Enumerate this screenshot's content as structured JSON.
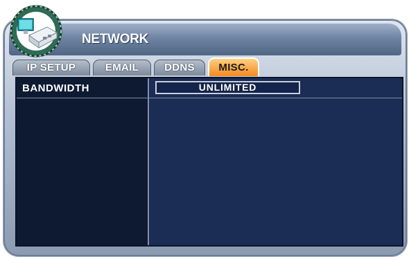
{
  "window": {
    "title": "NETWORK",
    "logo_icon": "network-dvr-icon"
  },
  "tabs": [
    {
      "label": "IP SETUP",
      "active": false
    },
    {
      "label": "EMAIL",
      "active": false
    },
    {
      "label": "DDNS",
      "active": false
    },
    {
      "label": "MISC.",
      "active": true
    }
  ],
  "settings": {
    "bandwidth_label": "BANDWIDTH",
    "bandwidth_value": "UNLIMITED"
  },
  "colors": {
    "active_tab": "#f5982e",
    "content_bg": "#1b2c55",
    "left_col_bg": "#0d1a32"
  }
}
